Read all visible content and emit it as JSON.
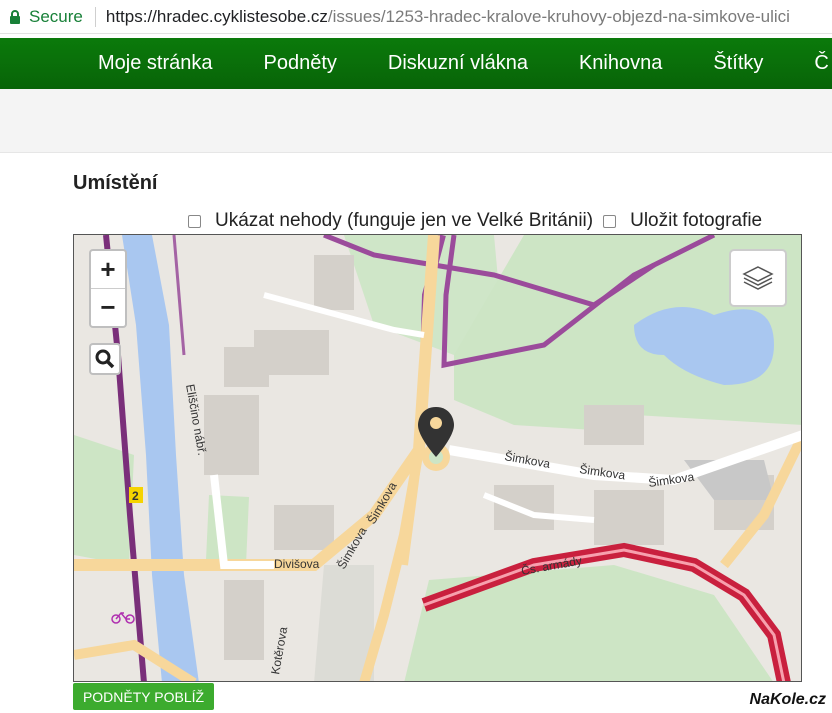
{
  "browser": {
    "secure_label": "Secure",
    "url_host": "https://hradec.cyklistesobe.cz",
    "url_path": "/issues/1253-hradec-kralove-kruhovy-objezd-na-simkove-ulici"
  },
  "nav": {
    "items": [
      "Moje stránka",
      "Podněty",
      "Diskuzní vlákna",
      "Knihovna",
      "Štítky",
      "Č"
    ]
  },
  "section": {
    "heading": "Umístění"
  },
  "options": {
    "accidents_label": "Ukázat nehody (funguje jen ve Velké Británii)",
    "photos_label": "Uložit fotografie"
  },
  "map": {
    "zoom_in": "+",
    "zoom_out": "−",
    "streets": [
      "Šimkova",
      "Šimkova",
      "Šimkova",
      "Šimkova",
      "Šimkova",
      "Eliščino nábř.",
      "Divišova",
      "Čs. armády",
      "Kotěrova",
      "2"
    ],
    "icons": [
      "zoom-in-icon",
      "zoom-out-icon",
      "search-icon",
      "layers-icon",
      "location-marker-icon",
      "bicycle-icon"
    ]
  },
  "nearby_button": "PODNĚTY POBLÍŽ",
  "watermark": "NaKole.cz"
}
